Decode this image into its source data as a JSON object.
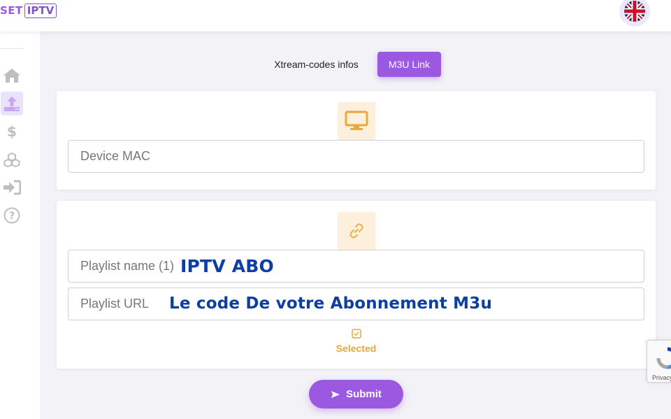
{
  "header": {
    "logo_set": "SET",
    "logo_iptv": "IPTV",
    "language_flag": "uk-flag-icon"
  },
  "sidebar": {
    "items": [
      {
        "icon": "home-icon",
        "active": false
      },
      {
        "icon": "upload-icon",
        "active": true
      },
      {
        "icon": "dollar-icon",
        "active": false
      },
      {
        "icon": "cubes-icon",
        "active": false
      },
      {
        "icon": "sign-in-icon",
        "active": false
      },
      {
        "icon": "help-icon",
        "active": false
      }
    ]
  },
  "tabs": {
    "xtream": "Xtream-codes infos",
    "m3u": "M3U Link",
    "active": "m3u"
  },
  "device": {
    "icon": "monitor-icon",
    "mac_placeholder": "Device MAC"
  },
  "playlist": {
    "icon": "link-icon",
    "name_placeholder": "Playlist name (1)",
    "name_value": "IPTV ABO",
    "url_placeholder": "Playlist URL",
    "url_value": "Le code De votre Abonnement M3u",
    "selected_icon": "checkbox-checked-icon",
    "selected_label": "Selected"
  },
  "submit": {
    "icon": "send-icon",
    "label": "Submit"
  },
  "recaptcha": {
    "text": "Privacy"
  },
  "colors": {
    "accent": "#9b58e0",
    "orange": "#e4a93a",
    "overlay_blue": "#0d3fa0"
  }
}
